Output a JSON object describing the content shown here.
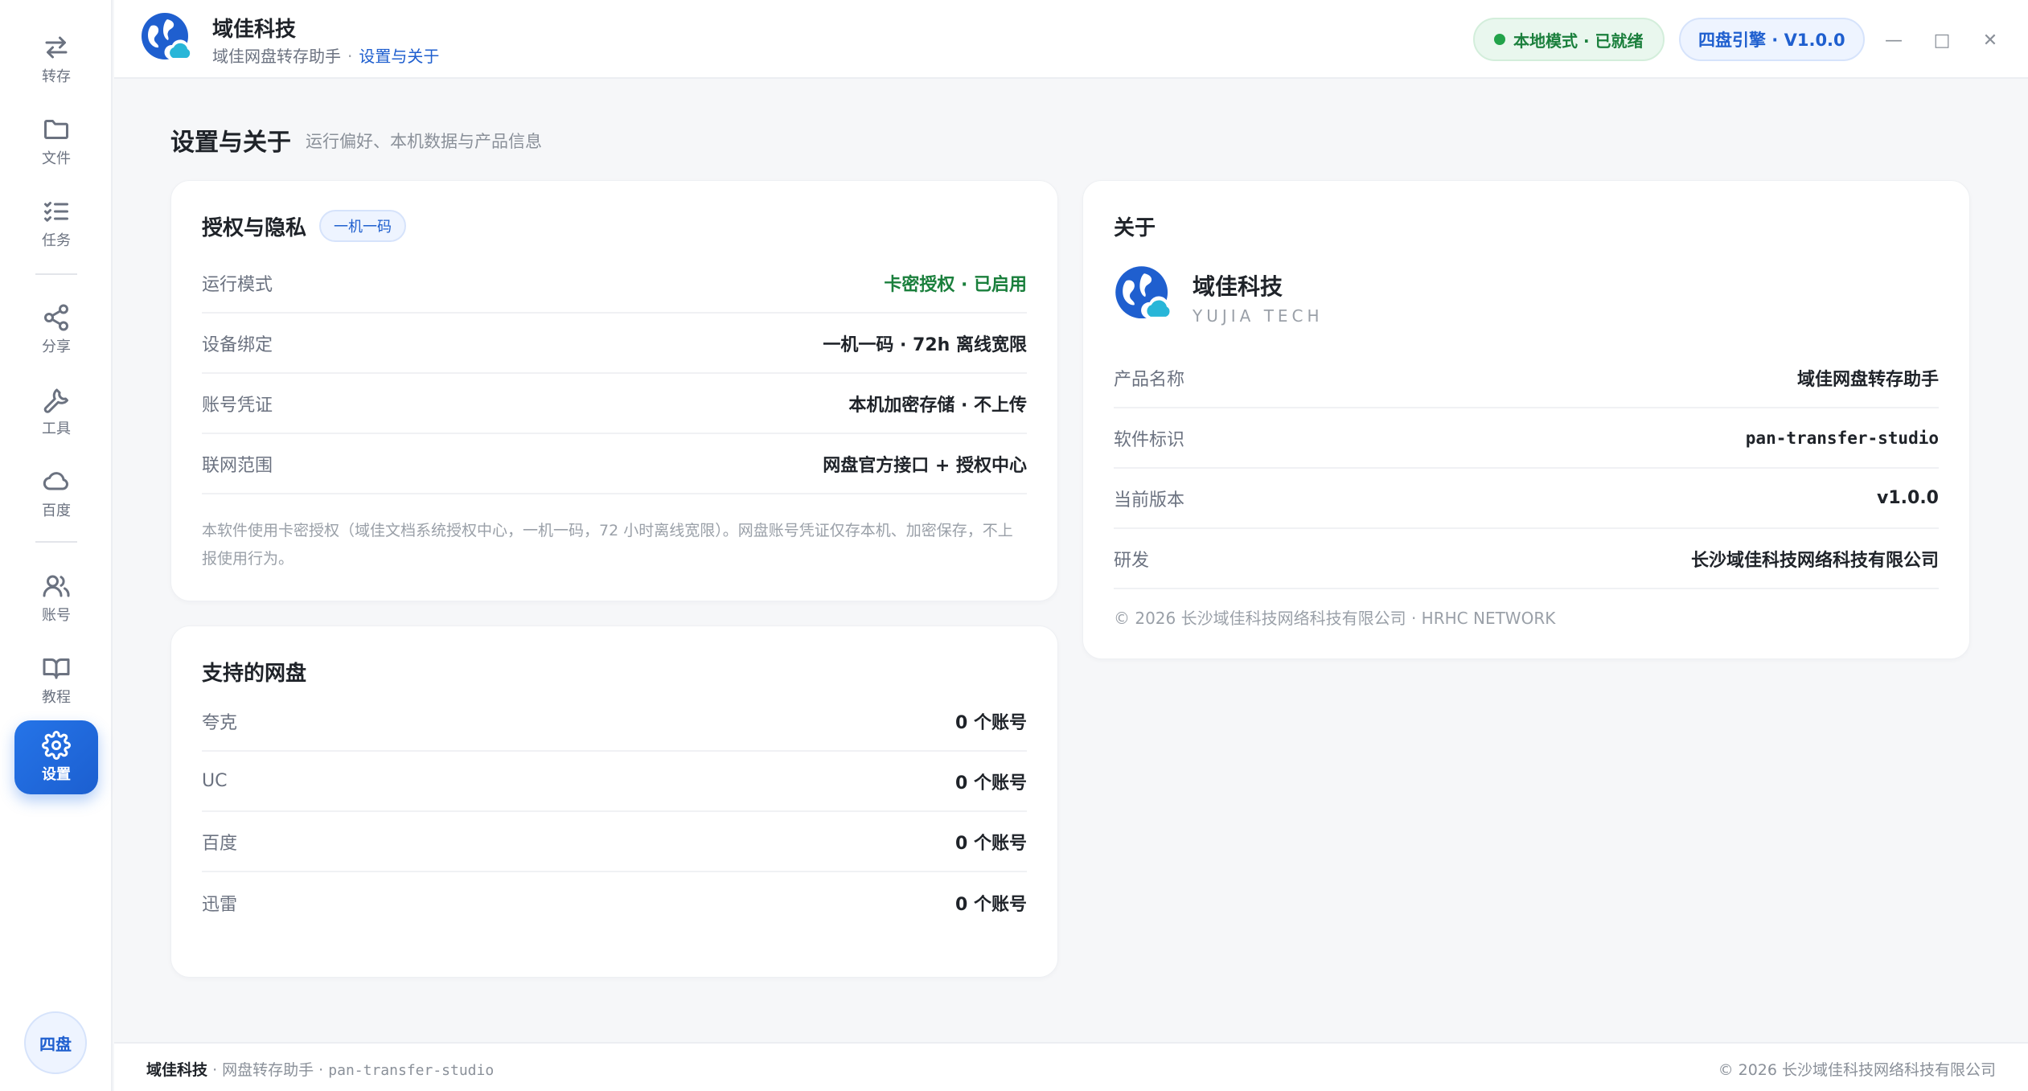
{
  "sidebar": {
    "items": [
      {
        "label": "转存",
        "icon": "transfer-arrows-icon"
      },
      {
        "label": "文件",
        "icon": "folder-icon"
      },
      {
        "label": "任务",
        "icon": "checklist-icon"
      },
      {
        "label": "分享",
        "icon": "share-icon"
      },
      {
        "label": "工具",
        "icon": "wrench-icon"
      },
      {
        "label": "百度",
        "icon": "cloud-icon"
      },
      {
        "label": "账号",
        "icon": "users-icon"
      },
      {
        "label": "教程",
        "icon": "book-icon"
      },
      {
        "label": "设置",
        "icon": "gear-icon"
      }
    ],
    "active": "设置",
    "engine_chip": "四盘"
  },
  "header": {
    "title": "域佳科技",
    "breadcrumb": {
      "root": "域佳网盘转存助手",
      "separator": "·",
      "current": "设置与关于"
    },
    "status": "本地模式 · 已就绪",
    "engine": "四盘引擎 · V1.0.0",
    "window_controls": {
      "minimize": "—",
      "maximize": "□",
      "close": "✕"
    }
  },
  "page": {
    "title": "设置与关于",
    "subtitle": "运行偏好、本机数据与产品信息"
  },
  "auth_card": {
    "title": "授权与隐私",
    "tag": "一机一码",
    "rows": [
      {
        "key": "运行模式",
        "value": "卡密授权 · 已启用"
      },
      {
        "key": "设备绑定",
        "value": "一机一码 · 72h 离线宽限"
      },
      {
        "key": "账号凭证",
        "value": "本机加密存储 · 不上传"
      },
      {
        "key": "联网范围",
        "value": "网盘官方接口 + 授权中心"
      }
    ],
    "note": "本软件使用卡密授权（域佳文档系统授权中心，一机一码，72 小时离线宽限）。网盘账号凭证仅存本机、加密保存，不上报使用行为。"
  },
  "drives_card": {
    "title": "支持的网盘",
    "rows": [
      {
        "key": "夸克",
        "value": "0 个账号"
      },
      {
        "key": "UC",
        "value": "0 个账号"
      },
      {
        "key": "百度",
        "value": "0 个账号"
      },
      {
        "key": "迅雷",
        "value": "0 个账号"
      }
    ]
  },
  "about_card": {
    "title": "关于",
    "brand_name": "域佳科技",
    "brand_en": "YUJIA TECH",
    "rows": [
      {
        "key": "产品名称",
        "value": "域佳网盘转存助手"
      },
      {
        "key": "软件标识",
        "value": "pan-transfer-studio"
      },
      {
        "key": "当前版本",
        "value": "v1.0.0"
      },
      {
        "key": "研发",
        "value": "长沙域佳科技网络科技有限公司"
      }
    ],
    "copyright": "© 2026 长沙域佳科技网络科技有限公司 · HRHC NETWORK"
  },
  "footer": {
    "brand": "域佳科技",
    "product": "· 网盘转存助手 ·",
    "id": "pan-transfer-studio",
    "copyright": "© 2026 长沙域佳科技网络科技有限公司"
  },
  "colors": {
    "accent": "#1f5fcf",
    "success": "#1a7f3c",
    "background": "#f6f7f9"
  }
}
